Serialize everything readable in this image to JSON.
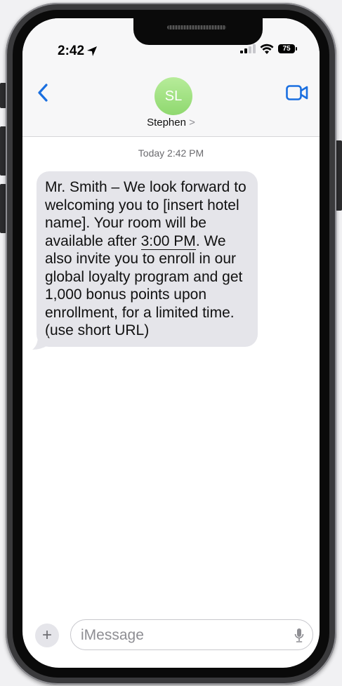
{
  "status_bar": {
    "time": "2:42",
    "battery": "75"
  },
  "header": {
    "avatar_initials": "SL",
    "contact_name": "Stephen",
    "contact_chevron": ">"
  },
  "conversation": {
    "timestamp": "Today 2:42 PM",
    "message": {
      "text_before": "Mr. Smith – We look forward to welcoming you to [insert hotel name].  Your room will be available after ",
      "underlined": "3:00 PM",
      "text_after": ". We also invite you to enroll in our global loyalty program and get 1,000 bonus points upon enrollment, for a limited time.  (use short URL)"
    }
  },
  "composer": {
    "plus_label": "+",
    "placeholder": "iMessage"
  },
  "icons": {
    "back": "chevron-left-icon",
    "video": "video-camera-icon",
    "location": "location-arrow-icon",
    "signal": "signal-bars-icon",
    "wifi": "wifi-icon",
    "battery": "battery-icon",
    "mic": "microphone-icon"
  },
  "colors": {
    "accent": "#1a6fe0",
    "bubble": "#e5e5ea",
    "avatar": "#a6e386",
    "frame": "#3a3a3c"
  }
}
